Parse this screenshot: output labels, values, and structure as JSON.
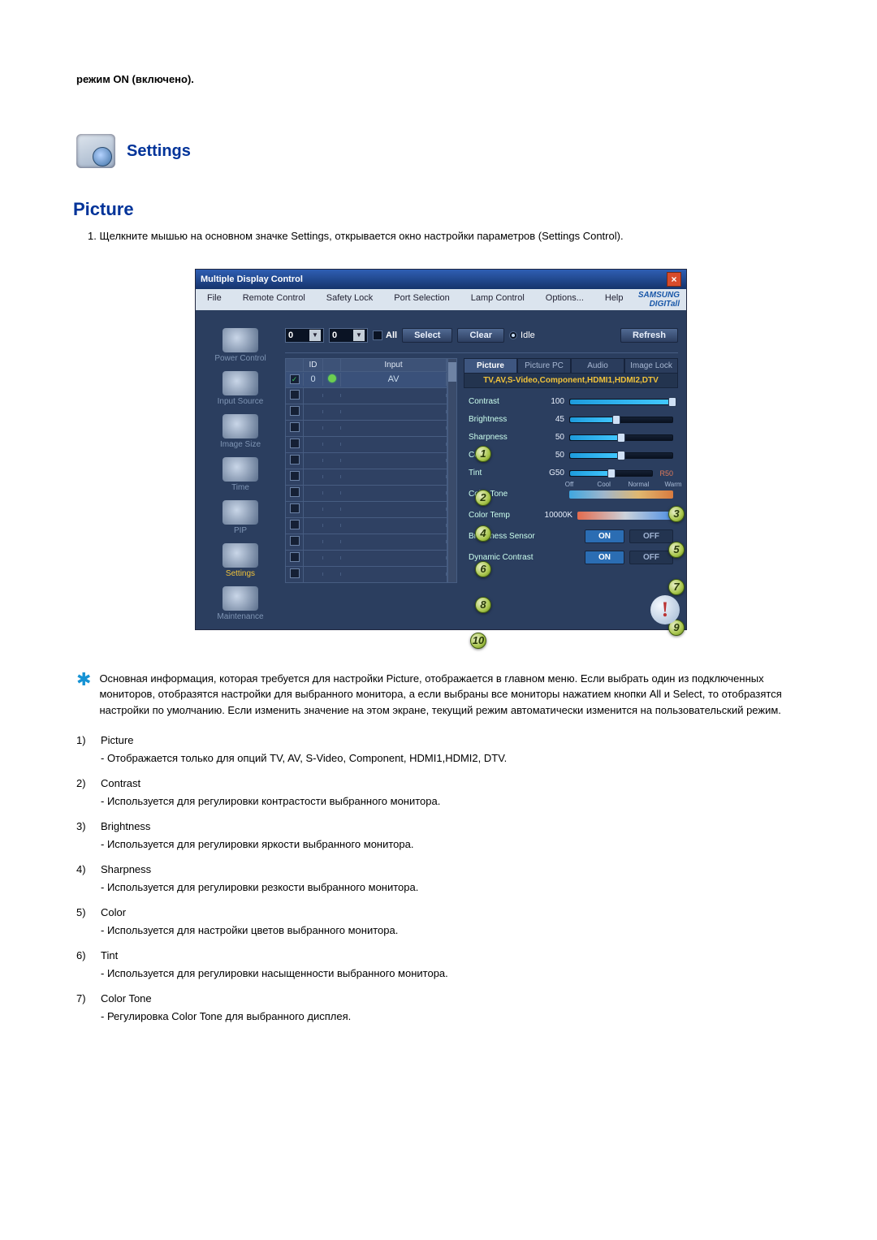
{
  "intro": "режим ON (включено).",
  "section_title": "Settings",
  "picture_title": "Picture",
  "step_text": "1.  Щелкните мышью на основном значке Settings, открывается окно настройки параметров (Settings Control).",
  "win": {
    "title": "Multiple Display Control",
    "brand": "SAMSUNG DIGITall",
    "menu": [
      "File",
      "Remote Control",
      "Safety Lock",
      "Port Selection",
      "Lamp Control",
      "Options...",
      "Help"
    ],
    "close": "×",
    "sel1": "0",
    "sel2": "0",
    "all_label": "All",
    "btn_select": "Select",
    "btn_clear": "Clear",
    "idle_label": "Idle",
    "btn_refresh": "Refresh",
    "sidebar": [
      {
        "label": "Power Control"
      },
      {
        "label": "Input Source"
      },
      {
        "label": "Image Size"
      },
      {
        "label": "Time"
      },
      {
        "label": "PIP"
      },
      {
        "label": "Settings",
        "active": true
      },
      {
        "label": "Maintenance"
      }
    ],
    "grid": {
      "headers": [
        "",
        "ID",
        "",
        "Input"
      ],
      "rows": [
        {
          "checked": true,
          "id": "0",
          "lamp": true,
          "input": "AV",
          "active": true
        },
        {
          "checked": false
        },
        {
          "checked": false
        },
        {
          "checked": false
        },
        {
          "checked": false
        },
        {
          "checked": false
        },
        {
          "checked": false
        },
        {
          "checked": false
        },
        {
          "checked": false
        },
        {
          "checked": false
        },
        {
          "checked": false
        },
        {
          "checked": false
        },
        {
          "checked": false
        }
      ]
    },
    "panel": {
      "tabs": [
        "Picture",
        "Picture PC",
        "Audio",
        "Image Lock"
      ],
      "active_tab": 0,
      "subheader": "TV,AV,S-Video,Component,HDMI1,HDMI2,DTV",
      "sliders": [
        {
          "label": "Contrast",
          "value": "100",
          "pct": 100
        },
        {
          "label": "Brightness",
          "value": "45",
          "pct": 45
        },
        {
          "label": "Sharpness",
          "value": "50",
          "pct": 50
        },
        {
          "label": "Color",
          "value": "50",
          "pct": 50
        },
        {
          "label": "Tint",
          "value": "G50",
          "pct": 50,
          "right": "R50"
        }
      ],
      "colortone": {
        "label": "Color Tone",
        "ticks": [
          "Off",
          "Cool",
          "Normal",
          "Warm"
        ]
      },
      "colortemp": {
        "label": "Color Temp",
        "value": "10000K"
      },
      "bsensor": {
        "label": "Brightness Sensor",
        "on": "ON",
        "off": "OFF"
      },
      "dcontrast": {
        "label": "Dynamic Contrast",
        "on": "ON",
        "off": "OFF"
      }
    },
    "callouts": [
      "1",
      "2",
      "3",
      "4",
      "5",
      "6",
      "7",
      "8",
      "9",
      "10"
    ]
  },
  "star_note": "Основная информация, которая требуется для настройки Picture, отображается в главном меню. Если выбрать один из подключенных мониторов, отобразятся настройки для выбранного монитора, а если выбраны все мониторы нажатием кнопки All и Select, то отобразятся настройки по умолчанию. Если изменить значение на этом экране, текущий режим автоматически изменится на пользовательский режим.",
  "items": [
    {
      "n": "1)",
      "t": "Picture",
      "d": "- Отображается только для опций TV, AV, S-Video, Component, HDMI1,HDMI2, DTV."
    },
    {
      "n": "2)",
      "t": "Contrast",
      "d": "- Используется для регулировки контрастости выбранного монитора."
    },
    {
      "n": "3)",
      "t": "Brightness",
      "d": "- Используется для регулировки яркости выбранного монитора."
    },
    {
      "n": "4)",
      "t": "Sharpness",
      "d": "- Используется для регулировки резкости выбранного монитора."
    },
    {
      "n": "5)",
      "t": "Color",
      "d": "- Используется для настройки цветов выбранного монитора."
    },
    {
      "n": "6)",
      "t": "Tint",
      "d": "- Используется для регулировки насыщенности выбранного монитора."
    },
    {
      "n": "7)",
      "t": "Color Tone",
      "d": "- Регулировка Color Tone для выбранного дисплея."
    }
  ]
}
